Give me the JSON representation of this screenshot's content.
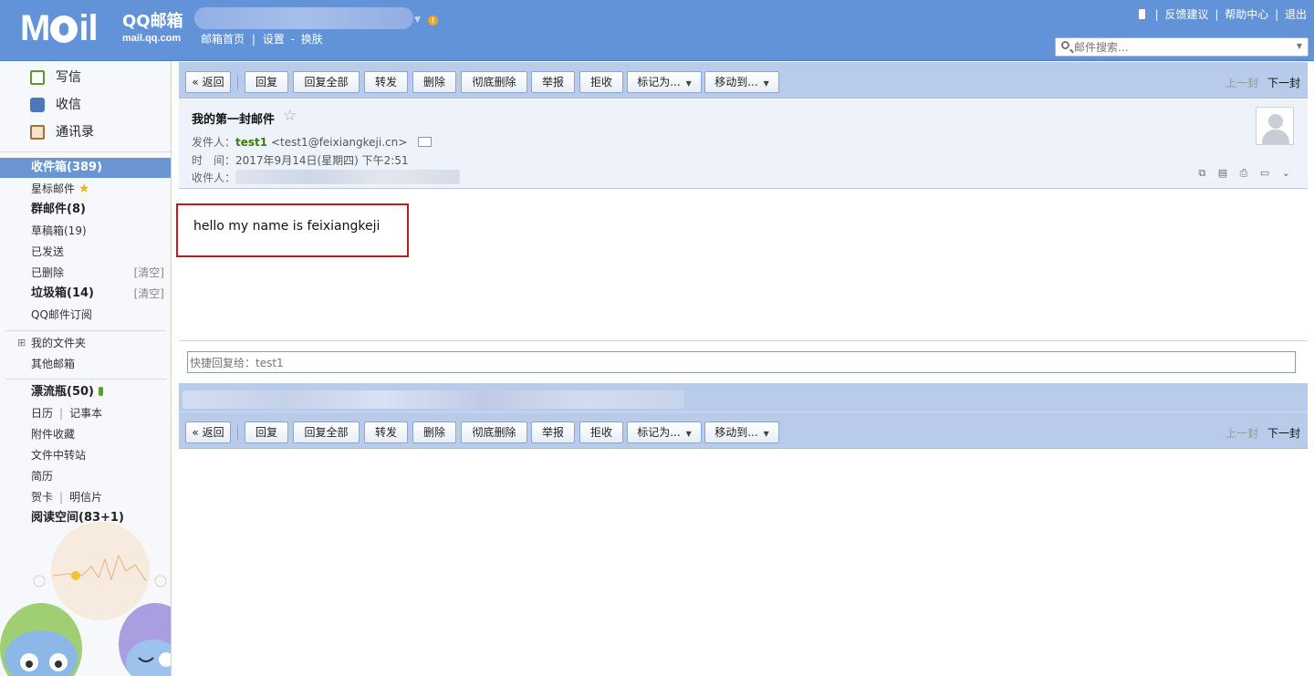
{
  "header": {
    "logo_text": "Mail",
    "brand_title": "QQ邮箱",
    "brand_domain": "mail.qq.com",
    "account_arrow": "▼",
    "warning_mark": "!",
    "nav": {
      "home": "邮箱首页",
      "divider": "|",
      "settings": "设置",
      "dash": "-",
      "skin": "换肤"
    },
    "links": {
      "feedback": "反馈建议",
      "help": "帮助中心",
      "logout": "退出",
      "divider": "|"
    },
    "search_placeholder": "邮件搜索..."
  },
  "sidebar": {
    "compose": "写信",
    "receive": "收信",
    "contacts": "通讯录",
    "folders": {
      "inbox": "收件箱(389)",
      "starred": "星标邮件",
      "group": "群邮件(8)",
      "drafts": "草稿箱(19)",
      "sent": "已发送",
      "deleted": "已删除",
      "deleted_clear": "[清空]",
      "junk": "垃圾箱(14)",
      "junk_clear": "[清空]",
      "subscriptions": "QQ邮件订阅",
      "my_folders": "我的文件夹",
      "other_mailbox": "其他邮箱",
      "drift_bottle": "漂流瓶(50)",
      "calendar": "日历",
      "notebook": "记事本",
      "attachments": "附件收藏",
      "file_transfer": "文件中转站",
      "resume": "简历",
      "greeting_card": "贺卡",
      "postcard": "明信片",
      "reading_space": "阅读空间(83+1)",
      "divider": "|",
      "tree_toggle": "⊞"
    }
  },
  "toolbar": {
    "back": "« 返回",
    "reply": "回复",
    "reply_all": "回复全部",
    "forward": "转发",
    "delete": "删除",
    "delete_perm": "彻底删除",
    "report": "举报",
    "reject": "拒收",
    "mark_as": "标记为...",
    "move_to": "移动到...",
    "prev": "上一封",
    "next": "下一封",
    "dropdown_arrow": "▼"
  },
  "message": {
    "subject": "我的第一封邮件",
    "star": "☆",
    "from_label": "发件人：",
    "from_name": "test1",
    "from_email": "<test1@feixiangkeji.cn>",
    "time_label": "时　间：",
    "time_value": "2017年9月14日(星期四) 下午2:51",
    "to_label": "收件人：",
    "body": "hello my name is feixiangkeji",
    "tool_icons": "⧉ ▤ ⎙ ▭ ⌄"
  },
  "quick_reply": {
    "placeholder": "快捷回复给：test1"
  }
}
